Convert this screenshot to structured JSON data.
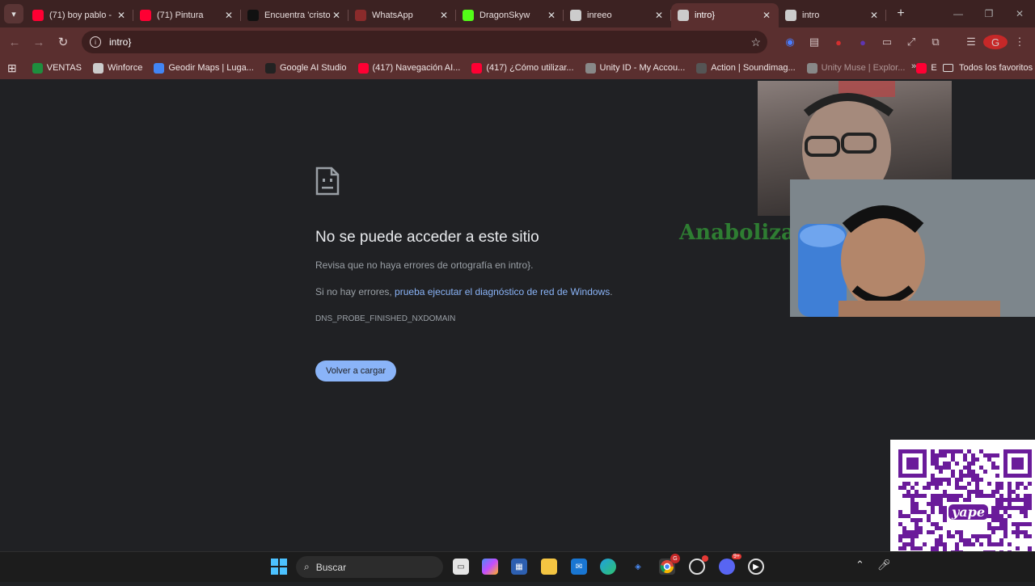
{
  "tabstrip": {
    "tabs": [
      {
        "title": "(71) boy pablo -",
        "favicon": "youtube-icon",
        "color": "#ff0033"
      },
      {
        "title": "(71) Pintura",
        "favicon": "youtube-icon",
        "color": "#ff0033"
      },
      {
        "title": "Encuentra 'cristo",
        "favicon": "tiktok-icon",
        "color": "#111111"
      },
      {
        "title": "WhatsApp",
        "favicon": "whatsapp-icon",
        "color": "#8b2b2b"
      },
      {
        "title": "DragonSkyw",
        "favicon": "kick-icon",
        "color": "#53fc18"
      },
      {
        "title": "inreeo",
        "favicon": "globe-icon",
        "color": "#cccccc"
      },
      {
        "title": "intro}",
        "favicon": "globe-icon",
        "color": "#cccccc",
        "active": true
      },
      {
        "title": "intro",
        "favicon": "globe-icon",
        "color": "#cccccc"
      }
    ]
  },
  "toolbar": {
    "url": "intro}",
    "avatar_letter": "G"
  },
  "bookmarks": {
    "items": [
      {
        "label": "VENTAS",
        "icon": "sheets-icon",
        "color": "#1e8e3e"
      },
      {
        "label": "Winforce",
        "icon": "globe-icon",
        "color": "#cccccc"
      },
      {
        "label": "Geodir Maps | Luga...",
        "icon": "map-pin-icon",
        "color": "#4285f4"
      },
      {
        "label": "Google AI Studio",
        "icon": "ai-studio-icon",
        "color": "#222222"
      },
      {
        "label": "(417) Navegación AI...",
        "icon": "youtube-icon",
        "color": "#ff0033"
      },
      {
        "label": "(417) ¿Cómo utilizar...",
        "icon": "youtube-icon",
        "color": "#ff0033"
      },
      {
        "label": "Unity ID - My Accou...",
        "icon": "unity-icon",
        "color": "#888888"
      },
      {
        "label": "Action | Soundimag...",
        "icon": "soundimage-icon",
        "color": "#555555"
      },
      {
        "label": "Unity Muse | Explor...",
        "icon": "unity-icon",
        "color": "#888888"
      },
      {
        "label": "E",
        "icon": "youtube-icon",
        "color": "#ff0033"
      }
    ],
    "all_bookmarks_label": "Todos los favoritos"
  },
  "error_page": {
    "title": "No se puede acceder a este sitio",
    "line1": "Revisa que no haya errores de ortografía en intro}.",
    "line2_prefix": "Si no hay errores, ",
    "line2_link": "prueba ejecutar el diagnóstico de red de Windows",
    "line2_suffix": ".",
    "error_code": "DNS_PROBE_FINISHED_NXDOMAIN",
    "reload_label": "Volver a cargar"
  },
  "overlay": {
    "banner_text": "Anabolizad"
  },
  "qr": {
    "brand": "yape"
  },
  "taskbar": {
    "search_placeholder": "Buscar",
    "discord_badge": "9+",
    "chrome_badge": "G"
  }
}
